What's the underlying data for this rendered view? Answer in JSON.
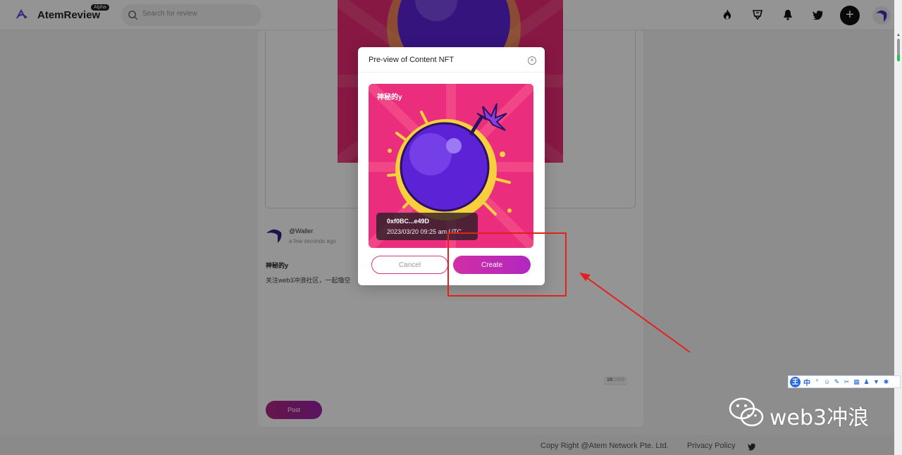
{
  "app": {
    "name": "AtemReview",
    "badge": "Alpha",
    "search_placeholder": "Search for review"
  },
  "nav_icons": [
    "fire-icon",
    "trophy-icon",
    "bell-icon",
    "twitter-icon"
  ],
  "post": {
    "username": "@Waller",
    "time": "a few seconds ago",
    "title": "神秘的y",
    "body": "关注web3冲浪社区，一起撸空",
    "char_count": "16",
    "char_max": "/1000",
    "post_label": "Post"
  },
  "footer": {
    "copyright": "Copy Right @Atem Network Pte. Ltd.",
    "policy": "Privacy Policy"
  },
  "modal": {
    "title": "Pre-view of Content NFT",
    "nft_name": "神秘的y",
    "address": "0xf0BC...e49D",
    "date": "2023/03/20 09:25 am UTC",
    "cancel_label": "Cancel",
    "create_label": "Create"
  },
  "ime": {
    "logo": "王",
    "mode": "中"
  },
  "watermark": {
    "text": "web3冲浪"
  },
  "colors": {
    "accent": "#c42bb1",
    "annotation": "#e3211c"
  }
}
